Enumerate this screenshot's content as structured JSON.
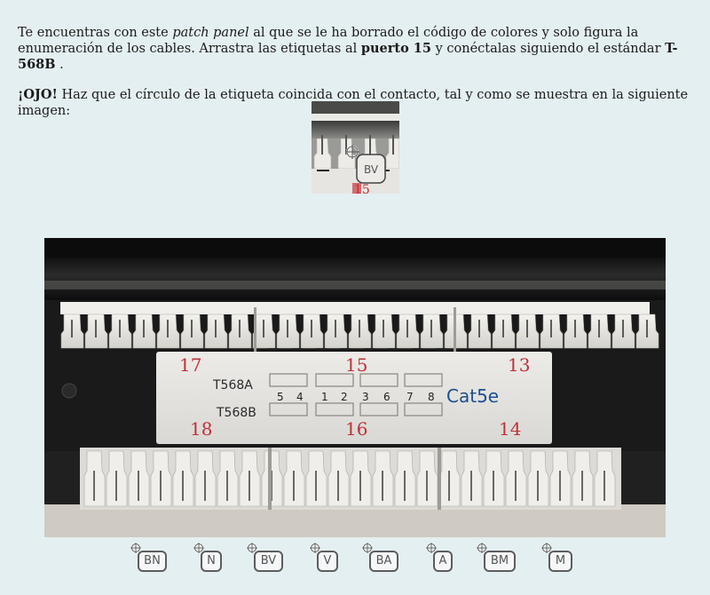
{
  "instructions": {
    "p1_a": "Te encuentras con este ",
    "p1_b": "patch panel",
    "p1_c": " al que se le ha borrado el código de colores y solo figura la enumeración de los cables. Arrastra las etiquetas al ",
    "p1_d": "puerto 15",
    "p1_e": " y conéctalas siguiendo el estándar ",
    "p1_f": "T-568B",
    "p1_g": " .",
    "p2_a": "¡OJO!",
    "p2_b": " Haz que el círculo de la etiqueta coincida con el contacto, tal y como se muestra en la siguiente imagen:"
  },
  "example": {
    "tag_label": "BV",
    "port_number": "15"
  },
  "panel": {
    "port_left_top": "17",
    "port_center_top": "15",
    "port_right_top": "13",
    "port_left_bottom": "18",
    "port_center_bottom": "16",
    "port_right_bottom": "14",
    "label_a": "T568A",
    "label_b": "T568B",
    "numbers": [
      "5",
      "4",
      "1",
      "2",
      "3",
      "6",
      "7",
      "8"
    ],
    "cat": "Cat5e"
  },
  "tags": [
    {
      "label": "BN"
    },
    {
      "label": "N"
    },
    {
      "label": "BV"
    },
    {
      "label": "V"
    },
    {
      "label": "BA"
    },
    {
      "label": "A"
    },
    {
      "label": "BM"
    },
    {
      "label": "M"
    }
  ],
  "colors": {
    "background": "#e4eff1",
    "tag_border": "#5d5d5d",
    "port_number_red": "#c0303a",
    "cat_blue": "#1d4f8f"
  }
}
